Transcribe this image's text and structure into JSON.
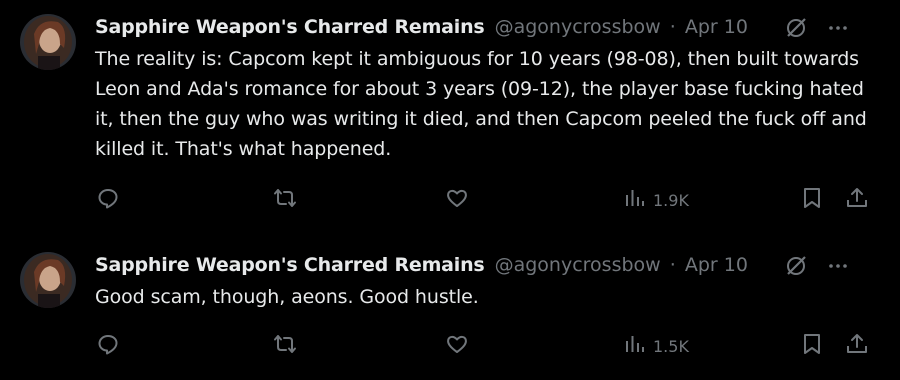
{
  "tweets": [
    {
      "author": {
        "name": "Sapphire Weapon's Charred Remains",
        "handle": "@agonycrossbow"
      },
      "separator": "·",
      "date": "Apr 10",
      "text": "The reality is: Capcom kept it ambiguous for 10 years (98-08), then built towards Leon and Ada's romance for about 3 years (09-12), the player base fucking hated it, then the guy who was writing it died, and then Capcom peeled the fuck off and killed it. That's what happened.",
      "views": "1.9K"
    },
    {
      "author": {
        "name": "Sapphire Weapon's Charred Remains",
        "handle": "@agonycrossbow"
      },
      "separator": "·",
      "date": "Apr 10",
      "text": "Good scam, though, aeons. Good hustle.",
      "views": "1.5K"
    }
  ],
  "icons": {
    "reply": "reply-icon",
    "retweet": "retweet-icon",
    "like": "heart-icon",
    "views": "views-icon",
    "bookmark": "bookmark-icon",
    "share": "share-icon",
    "grok": "grok-icon",
    "more": "more-icon"
  },
  "colors": {
    "background": "#000000",
    "text": "#e7e9ea",
    "secondary": "#71767b"
  }
}
